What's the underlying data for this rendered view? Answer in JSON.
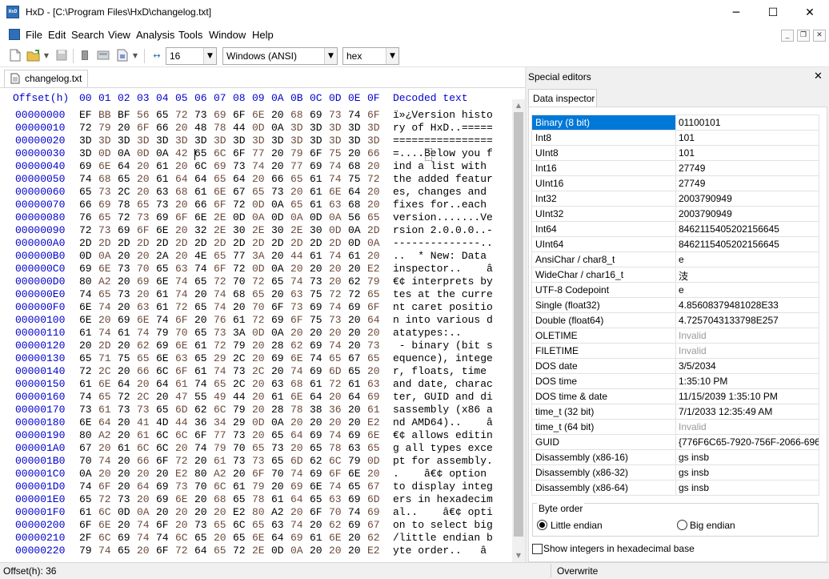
{
  "window": {
    "icon_text": "HxD",
    "title": "HxD - [C:\\Program Files\\HxD\\changelog.txt]"
  },
  "window_controls": {
    "minimize": "─",
    "maximize": "☐",
    "close": "✕"
  },
  "menu": [
    "File",
    "Edit",
    "Search",
    "View",
    "Analysis",
    "Tools",
    "Window",
    "Help"
  ],
  "mdi_controls": {
    "minimize": "_",
    "restore": "❐",
    "close": "✕"
  },
  "toolbar": {
    "bytes_per_row": "16",
    "charset": "Windows (ANSI)",
    "offset_base": "hex"
  },
  "document_tab": "changelog.txt",
  "editor": {
    "header_offset": "Offset(h)",
    "header_bytes": [
      "00",
      "01",
      "02",
      "03",
      "04",
      "05",
      "06",
      "07",
      "08",
      "09",
      "0A",
      "0B",
      "0C",
      "0D",
      "0E",
      "0F"
    ],
    "header_decoded": "Decoded text",
    "rows": [
      {
        "offset": "00000000",
        "hex": "EF BB BF 56 65 72 73 69 6F 6E 20 68 69 73 74 6F",
        "text": "ï»¿Version histo"
      },
      {
        "offset": "00000010",
        "hex": "72 79 20 6F 66 20 48 78 44 0D 0A 3D 3D 3D 3D 3D",
        "text": "ry of HxD..====="
      },
      {
        "offset": "00000020",
        "hex": "3D 3D 3D 3D 3D 3D 3D 3D 3D 3D 3D 3D 3D 3D 3D 3D",
        "text": "================"
      },
      {
        "offset": "00000030",
        "hex": "3D 0D 0A 0D 0A 42 65 6C 6F 77 20 79 6F 75 20 66",
        "text": "=....Below you f"
      },
      {
        "offset": "00000040",
        "hex": "69 6E 64 20 61 20 6C 69 73 74 20 77 69 74 68 20",
        "text": "ind a list with "
      },
      {
        "offset": "00000050",
        "hex": "74 68 65 20 61 64 64 65 64 20 66 65 61 74 75 72",
        "text": "the added featur"
      },
      {
        "offset": "00000060",
        "hex": "65 73 2C 20 63 68 61 6E 67 65 73 20 61 6E 64 20",
        "text": "es, changes and "
      },
      {
        "offset": "00000070",
        "hex": "66 69 78 65 73 20 66 6F 72 0D 0A 65 61 63 68 20",
        "text": "fixes for..each "
      },
      {
        "offset": "00000080",
        "hex": "76 65 72 73 69 6F 6E 2E 0D 0A 0D 0A 0D 0A 56 65",
        "text": "version.......Ve"
      },
      {
        "offset": "00000090",
        "hex": "72 73 69 6F 6E 20 32 2E 30 2E 30 2E 30 0D 0A 2D",
        "text": "rsion 2.0.0.0..-"
      },
      {
        "offset": "000000A0",
        "hex": "2D 2D 2D 2D 2D 2D 2D 2D 2D 2D 2D 2D 2D 2D 0D 0A",
        "text": "--------------.."
      },
      {
        "offset": "000000B0",
        "hex": "0D 0A 20 20 2A 20 4E 65 77 3A 20 44 61 74 61 20",
        "text": "..  * New: Data "
      },
      {
        "offset": "000000C0",
        "hex": "69 6E 73 70 65 63 74 6F 72 0D 0A 20 20 20 20 E2",
        "text": "inspector..    â"
      },
      {
        "offset": "000000D0",
        "hex": "80 A2 20 69 6E 74 65 72 70 72 65 74 73 20 62 79",
        "text": "€¢ interprets by"
      },
      {
        "offset": "000000E0",
        "hex": "74 65 73 20 61 74 20 74 68 65 20 63 75 72 72 65",
        "text": "tes at the curre"
      },
      {
        "offset": "000000F0",
        "hex": "6E 74 20 63 61 72 65 74 20 70 6F 73 69 74 69 6F",
        "text": "nt caret positio"
      },
      {
        "offset": "00000100",
        "hex": "6E 20 69 6E 74 6F 20 76 61 72 69 6F 75 73 20 64",
        "text": "n into various d"
      },
      {
        "offset": "00000110",
        "hex": "61 74 61 74 79 70 65 73 3A 0D 0A 20 20 20 20 20",
        "text": "atatypes:..     "
      },
      {
        "offset": "00000120",
        "hex": "20 2D 20 62 69 6E 61 72 79 20 28 62 69 74 20 73",
        "text": " - binary (bit s"
      },
      {
        "offset": "00000130",
        "hex": "65 71 75 65 6E 63 65 29 2C 20 69 6E 74 65 67 65",
        "text": "equence), intege"
      },
      {
        "offset": "00000140",
        "hex": "72 2C 20 66 6C 6F 61 74 73 2C 20 74 69 6D 65 20",
        "text": "r, floats, time "
      },
      {
        "offset": "00000150",
        "hex": "61 6E 64 20 64 61 74 65 2C 20 63 68 61 72 61 63",
        "text": "and date, charac"
      },
      {
        "offset": "00000160",
        "hex": "74 65 72 2C 20 47 55 49 44 20 61 6E 64 20 64 69",
        "text": "ter, GUID and di"
      },
      {
        "offset": "00000170",
        "hex": "73 61 73 73 65 6D 62 6C 79 20 28 78 38 36 20 61",
        "text": "sassembly (x86 a"
      },
      {
        "offset": "00000180",
        "hex": "6E 64 20 41 4D 44 36 34 29 0D 0A 20 20 20 20 E2",
        "text": "nd AMD64)..    â"
      },
      {
        "offset": "00000190",
        "hex": "80 A2 20 61 6C 6C 6F 77 73 20 65 64 69 74 69 6E",
        "text": "€¢ allows editin"
      },
      {
        "offset": "000001A0",
        "hex": "67 20 61 6C 6C 20 74 79 70 65 73 20 65 78 63 65",
        "text": "g all types exce"
      },
      {
        "offset": "000001B0",
        "hex": "70 74 20 66 6F 72 20 61 73 73 65 6D 62 6C 79 0D",
        "text": "pt for assembly."
      },
      {
        "offset": "000001C0",
        "hex": "0A 20 20 20 20 E2 80 A2 20 6F 70 74 69 6F 6E 20",
        "text": ".    â€¢ option "
      },
      {
        "offset": "000001D0",
        "hex": "74 6F 20 64 69 73 70 6C 61 79 20 69 6E 74 65 67",
        "text": "to display integ"
      },
      {
        "offset": "000001E0",
        "hex": "65 72 73 20 69 6E 20 68 65 78 61 64 65 63 69 6D",
        "text": "ers in hexadecim"
      },
      {
        "offset": "000001F0",
        "hex": "61 6C 0D 0A 20 20 20 20 E2 80 A2 20 6F 70 74 69",
        "text": "al..    â€¢ opti"
      },
      {
        "offset": "00000200",
        "hex": "6F 6E 20 74 6F 20 73 65 6C 65 63 74 20 62 69 67",
        "text": "on to select big"
      },
      {
        "offset": "00000210",
        "hex": "2F 6C 69 74 74 6C 65 20 65 6E 64 69 61 6E 20 62",
        "text": "/little endian b"
      },
      {
        "offset": "00000220",
        "hex": "79 74 65 20 6F 72 64 65 72 2E 0D 0A 20 20 20 E2",
        "text": "yte order..   â"
      }
    ]
  },
  "special_editors": {
    "title": "Special editors",
    "close": "✕",
    "tab": "Data inspector",
    "rows": [
      {
        "label": "Binary (8 bit)",
        "value": "01100101",
        "selected": true
      },
      {
        "label": "Int8",
        "value": "101"
      },
      {
        "label": "UInt8",
        "value": "101"
      },
      {
        "label": "Int16",
        "value": "27749"
      },
      {
        "label": "UInt16",
        "value": "27749"
      },
      {
        "label": "Int32",
        "value": "2003790949"
      },
      {
        "label": "UInt32",
        "value": "2003790949"
      },
      {
        "label": "Int64",
        "value": "8462115405202156645"
      },
      {
        "label": "UInt64",
        "value": "8462115405202156645"
      },
      {
        "label": "AnsiChar / char8_t",
        "value": "e"
      },
      {
        "label": "WideChar / char16_t",
        "value": "汥"
      },
      {
        "label": "UTF-8 Codepoint",
        "value": "e"
      },
      {
        "label": "Single (float32)",
        "value": "4.85608379481028E33"
      },
      {
        "label": "Double (float64)",
        "value": "4.7257043133798E257"
      },
      {
        "label": "OLETIME",
        "value": "Invalid",
        "dim": true
      },
      {
        "label": "FILETIME",
        "value": "Invalid",
        "dim": true
      },
      {
        "label": "DOS date",
        "value": "3/5/2034"
      },
      {
        "label": "DOS time",
        "value": "1:35:10 PM"
      },
      {
        "label": "DOS time & date",
        "value": "11/15/2039 1:35:10 PM"
      },
      {
        "label": "time_t (32 bit)",
        "value": "7/1/2033 12:35:49 AM"
      },
      {
        "label": "time_t (64 bit)",
        "value": "Invalid",
        "dim": true
      },
      {
        "label": "GUID",
        "value": "{776F6C65-7920-756F-2066-696E6"
      },
      {
        "label": "Disassembly (x86-16)",
        "value": "gs insb"
      },
      {
        "label": "Disassembly (x86-32)",
        "value": "gs insb"
      },
      {
        "label": "Disassembly (x86-64)",
        "value": "gs insb"
      }
    ],
    "byte_order_label": "Byte order",
    "little_endian": "Little endian",
    "big_endian": "Big endian",
    "byte_order_selected": "little",
    "hex_checkbox": "Show integers in hexadecimal base",
    "hex_checked": false
  },
  "statusbar": {
    "offset": "Offset(h): 36",
    "mode": "Overwrite"
  }
}
